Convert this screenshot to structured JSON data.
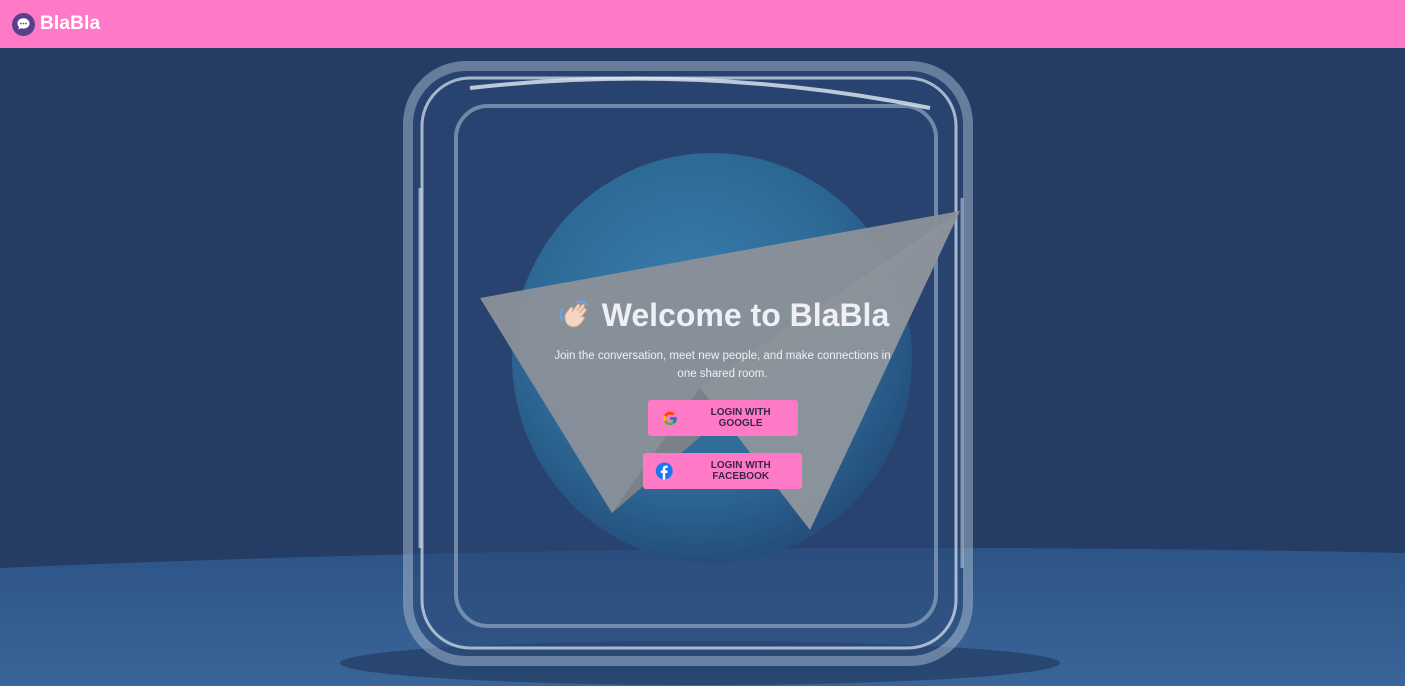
{
  "navbar": {
    "brand_name": "BlaBla",
    "logo_icon": "chat-bubble-icon",
    "background": "#ff7ac6"
  },
  "hero": {
    "title": "Welcome to BlaBla",
    "title_icon": "waving-hand-icon",
    "subtitle": "Join the conversation, meet new people, and make connections in one shared room.",
    "background_art": "glass-frame-paper-plane"
  },
  "buttons": {
    "google": {
      "label": "LOGIN WITH GOOGLE",
      "icon": "google-icon"
    },
    "facebook": {
      "label": "LOGIN WITH FACEBOOK",
      "icon": "facebook-icon"
    }
  },
  "colors": {
    "accent": "#ff7ac6",
    "hero_bg": "#26426e",
    "button_text": "#3b2547"
  }
}
